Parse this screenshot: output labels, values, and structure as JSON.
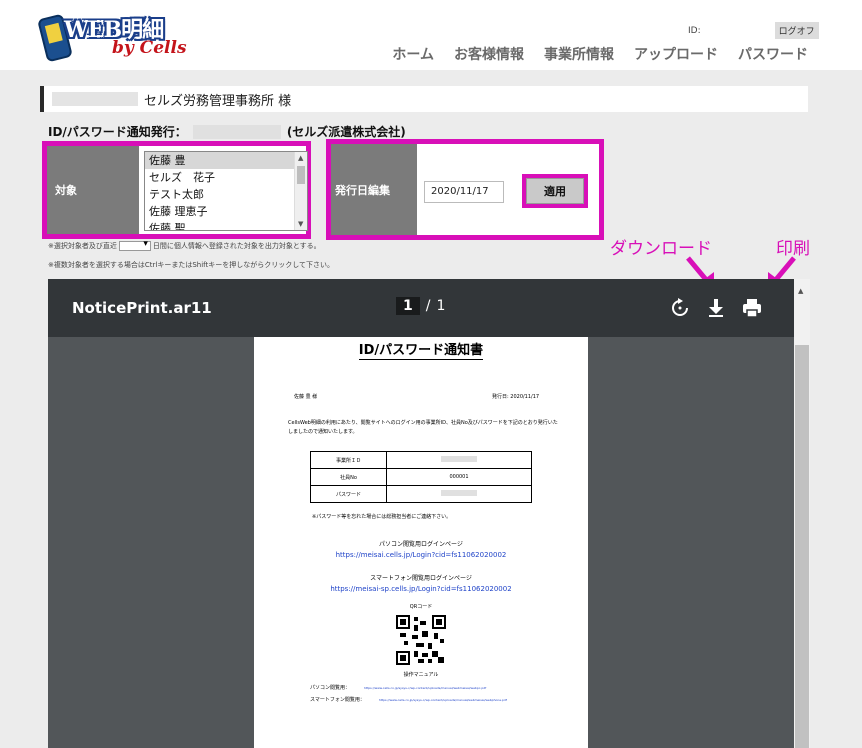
{
  "logo": {
    "main": "WEB明細",
    "sub": "by Cells"
  },
  "header": {
    "id_label": "ID:",
    "logout": "ログオフ"
  },
  "nav": [
    "ホーム",
    "お客様情報",
    "事業所情報",
    "アップロード",
    "パスワード"
  ],
  "title": {
    "suffix": "セルズ労務管理事務所 様"
  },
  "id_notice": {
    "label": "ID/パスワード通知発行：",
    "company": "(セルズ派遣株式会社)"
  },
  "target": {
    "label": "対象",
    "options": [
      "佐藤 豊",
      "セルズ　花子",
      "テスト太郎",
      "佐藤 理恵子",
      "佐藤 聖"
    ]
  },
  "issue_date": {
    "label": "発行日編集",
    "value": "2020/11/17",
    "apply": "適用"
  },
  "notes": {
    "line1_pre": "※選択対象者及び直近",
    "line1_post": "日間に個人情報へ登録された対象を出力対象とする。",
    "line2": "※複数対象者を選択する場合はCtrlキーまたはShiftキーを押しながらクリックして下さい。"
  },
  "annotations": {
    "download": "ダウンロード",
    "print": "印刷"
  },
  "viewer": {
    "filename": "NoticePrint.ar11",
    "page_current": "1",
    "page_sep": "/",
    "page_total": "1",
    "icons": [
      "rotate-icon",
      "download-icon",
      "print-icon"
    ]
  },
  "pdf": {
    "title": "ID/パスワード通知書",
    "name": "佐藤 豊 様",
    "date": "発行日: 2020/11/17",
    "body": "CellsWeb明細の利用にあたり、閲覧サイトへのログイン用の事業所ID、社員No及びパスワードを下記のとおり発行いたしましたので通知いたします。",
    "table": [
      {
        "key": "事業所ＩＤ",
        "value": ""
      },
      {
        "key": "社員No",
        "value": "000001"
      },
      {
        "key": "パスワード",
        "value": ""
      }
    ],
    "note": "※パスワード等を忘れた場合には総務担当者にご連絡下さい。",
    "pc_heading": "パソコン閲覧用ログインページ",
    "pc_url": "https://meisai.cells.jp/Login?cid=fs11062020002",
    "sp_heading": "スマートフォン閲覧用ログインページ",
    "sp_url": "https://meisai-sp.cells.jp/Login?cid=fs11062020002",
    "qr_label": "QRコード",
    "manual_heading": "操作マニュアル",
    "manual_pc": "パソコン閲覧用：",
    "manual_pc_url": "https://www.cells.co.jp/sysys-c/wp-content/uploads/manual/webmeisai/webpc.pdf",
    "manual_sp": "スマートフォン閲覧用：",
    "manual_sp_url": "https://www.cells.co.jp/sysys-c/wp-content/uploads/manual/webmeisai/webphone.pdf"
  },
  "colors": {
    "highlight": "#d80fb8",
    "label_bg": "#7b7b7b",
    "toolbar": "#323639"
  }
}
